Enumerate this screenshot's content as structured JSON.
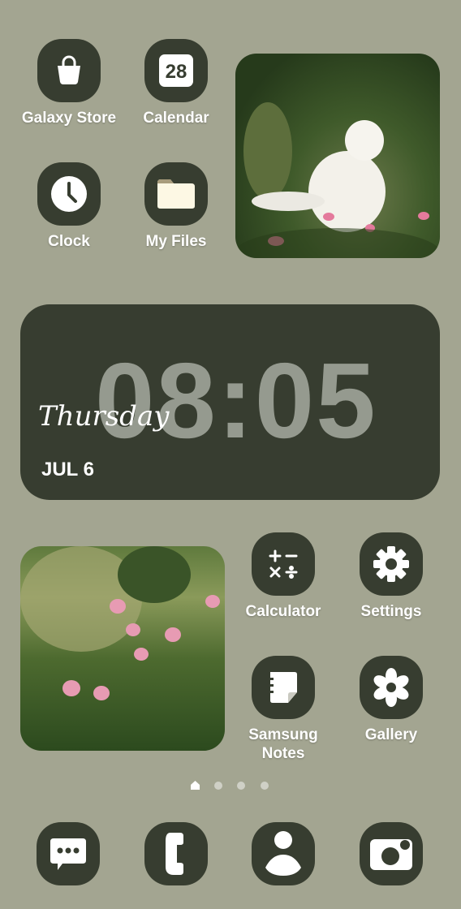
{
  "colors": {
    "background": "#a3a591",
    "icon_bg": "#373d30",
    "clock_digits": "#959a8f"
  },
  "apps": [
    {
      "label": "Galaxy Store",
      "icon": "shopping-bag-icon"
    },
    {
      "label": "Calendar",
      "icon": "calendar-icon",
      "badge": "28"
    },
    {
      "label": "Clock",
      "icon": "clock-icon"
    },
    {
      "label": "My Files",
      "icon": "folder-icon"
    },
    {
      "label": "Calculator",
      "icon": "calculator-icon"
    },
    {
      "label": "Settings",
      "icon": "gear-icon"
    },
    {
      "label": "Samsung Notes",
      "icon": "notes-icon"
    },
    {
      "label": "Gallery",
      "icon": "flower-icon"
    }
  ],
  "clock_widget": {
    "time": "08:05",
    "day": "Thursday",
    "date": "JUL 6"
  },
  "page_indicator": {
    "pages": 4,
    "current": "home"
  },
  "dock": [
    {
      "icon": "messages-icon"
    },
    {
      "icon": "phone-icon"
    },
    {
      "icon": "contacts-icon"
    },
    {
      "icon": "camera-icon"
    }
  ]
}
